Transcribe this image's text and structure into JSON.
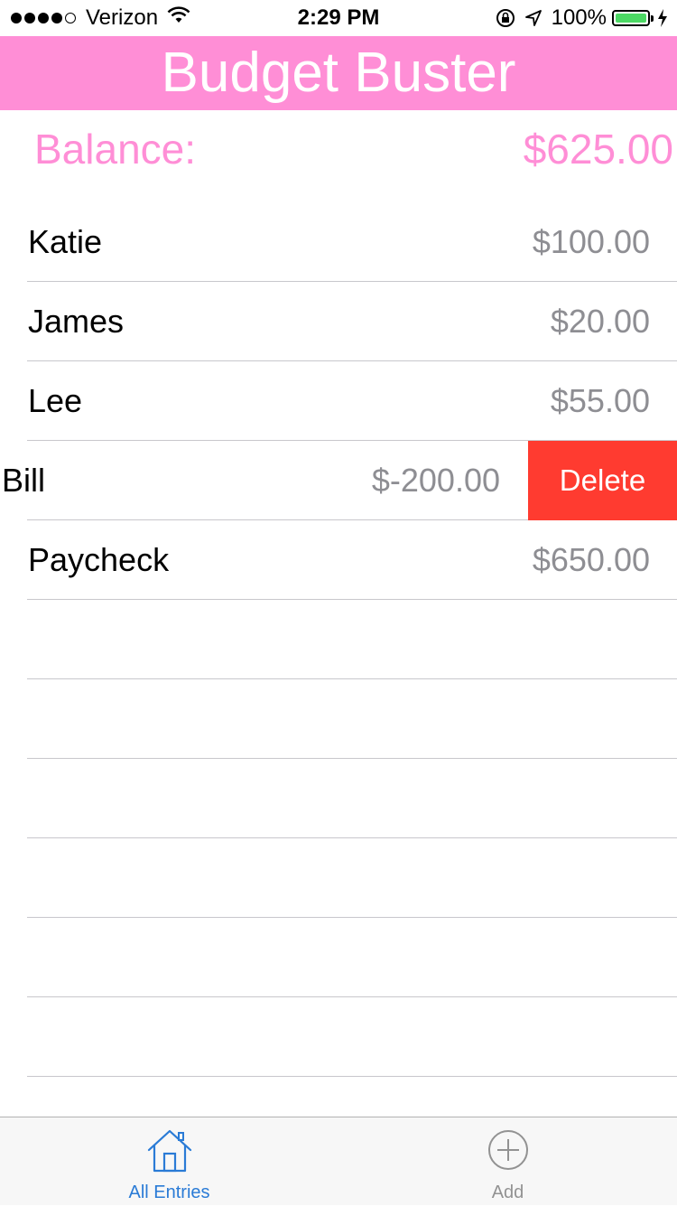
{
  "status_bar": {
    "carrier": "Verizon",
    "time": "2:29 PM",
    "battery_percent": "100%"
  },
  "header": {
    "title": "Budget Buster"
  },
  "balance": {
    "label": "Balance:",
    "value": "$625.00"
  },
  "entries": [
    {
      "name": "Katie",
      "amount": "$100.00"
    },
    {
      "name": "James",
      "amount": "$20.00"
    },
    {
      "name": "Lee",
      "amount": "$55.00"
    },
    {
      "name": "Bill",
      "amount": "$-200.00",
      "delete_label": "Delete"
    },
    {
      "name": "Paycheck",
      "amount": "$650.00"
    }
  ],
  "tab_bar": {
    "tabs": [
      {
        "label": "All Entries",
        "icon": "house-icon",
        "selected": true
      },
      {
        "label": "Add",
        "icon": "plus-circle-icon",
        "selected": false
      }
    ]
  },
  "colors": {
    "accent": "#ff8ed6",
    "delete": "#ff3b30",
    "tab_active": "#2a7bd6",
    "tab_inactive": "#929292",
    "amount_text": "#8e8e93"
  }
}
